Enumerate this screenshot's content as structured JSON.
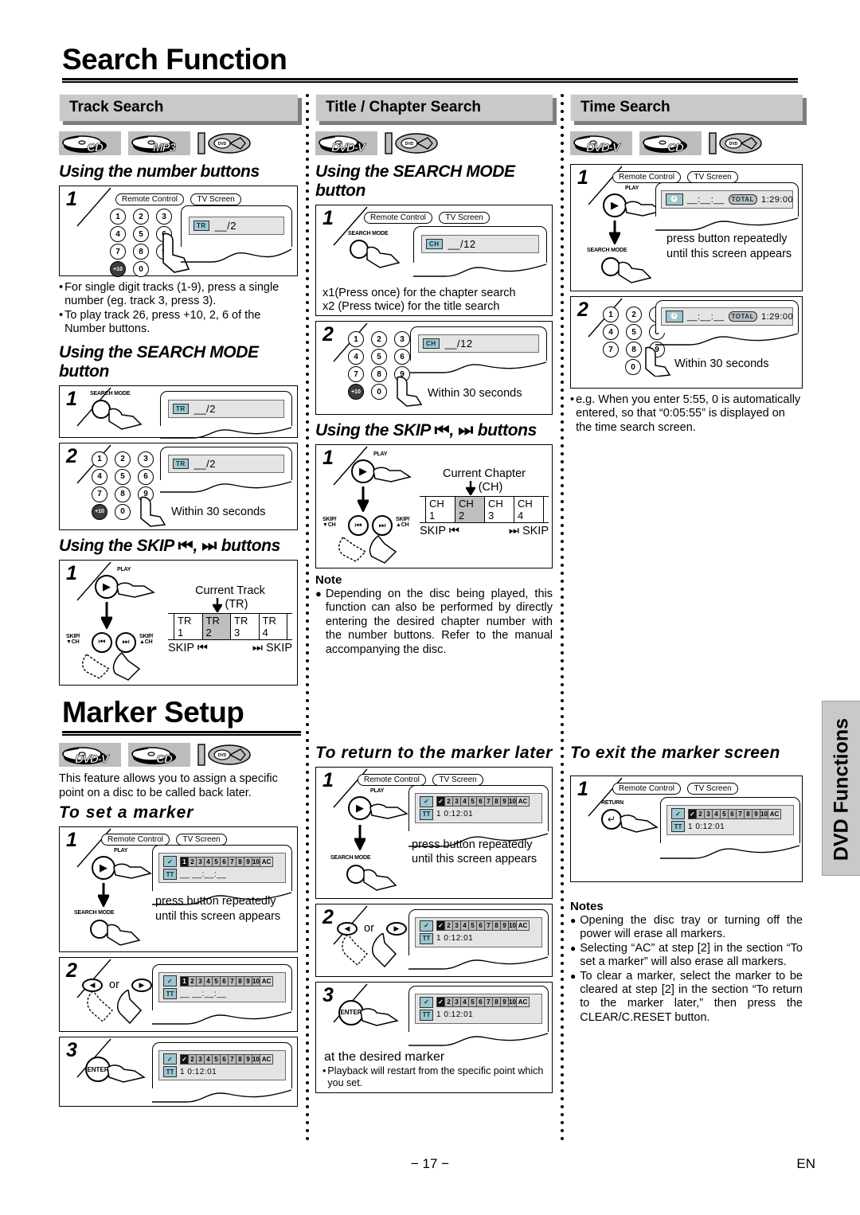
{
  "page": {
    "number": "− 17 −",
    "lang": "EN",
    "side_tab": "DVD Functions"
  },
  "sections": [
    {
      "id": "search_function",
      "title": "Search Function"
    },
    {
      "id": "marker_setup",
      "title": "Marker Setup"
    }
  ],
  "track_search": {
    "bar": "Track Search",
    "badges": [
      "CD",
      "MP3"
    ],
    "h_number": "Using the number buttons",
    "h_searchmode": "Using the SEARCH MODE button",
    "h_skip": "Using the SKIP",
    "h_skip_tail": "buttons",
    "callout_remote": "Remote Control",
    "callout_tv": "TV Screen",
    "osd_tag": "TR",
    "osd_value": "__/2",
    "searchmode_label": "SEARCH MODE",
    "within": "Within 30 seconds",
    "bullets": [
      "For single digit tracks (1-9), press a single number (eg. track 3, press 3).",
      "To play track 26, press +10, 2, 6 of the Number buttons."
    ],
    "play_label": "PLAY",
    "skip_down_label": "SKIP/▼CH",
    "skip_up_label": "SKIP/▲CH",
    "current_label": "Current Track",
    "current_unit": "(TR)",
    "cells": [
      "TR 1",
      "TR 2",
      "TR 3",
      "TR 4"
    ],
    "current_index": 1,
    "skip_left": "SKIP",
    "skip_right": "SKIP"
  },
  "title_chapter_search": {
    "bar": "Title / Chapter Search",
    "badges": [
      "DVD-V"
    ],
    "h_searchmode": "Using the SEARCH MODE button",
    "h_skip": "Using the SKIP",
    "h_skip_tail": "buttons",
    "callout_remote": "Remote Control",
    "callout_tv": "TV Screen",
    "osd_tag": "CH",
    "osd_value": "__/12",
    "searchmode_label": "SEARCH MODE",
    "press_lines": [
      "x1(Press once) for the chapter search",
      "x2 (Press twice) for the title search"
    ],
    "within": "Within 30 seconds",
    "play_label": "PLAY",
    "skip_down_label": "SKIP/▼CH",
    "skip_up_label": "SKIP/▲CH",
    "current_label": "Current Chapter",
    "current_unit": "(CH)",
    "cells": [
      "CH 1",
      "CH 2",
      "CH 3",
      "CH 4"
    ],
    "current_index": 1,
    "skip_left": "SKIP",
    "skip_right": "SKIP",
    "note_head": "Note",
    "note_body": "Depending on the disc being played, this function can also be performed by directly entering the desired chapter number with the number buttons. Refer to the manual accompanying the disc."
  },
  "time_search": {
    "bar": "Time Search",
    "badges": [
      "DVD-V",
      "CD"
    ],
    "callout_remote": "Remote Control",
    "callout_tv": "TV Screen",
    "play_label": "PLAY",
    "searchmode_label": "SEARCH MODE",
    "osd_clock_icon": "clock-icon",
    "osd_time_blank": "__:__:__",
    "osd_total_tag": "TOTAL",
    "osd_total_value": "1:29:00",
    "step1_text": "press button repeatedly until this screen appears",
    "within": "Within 30 seconds",
    "bullet": "e.g. When you enter 5:55, 0 is automatically entered, so that “0:05:55” is displayed on the time search screen."
  },
  "marker_setup": {
    "badges": [
      "DVD-V",
      "CD"
    ],
    "intro": "This feature allows you to assign a specific point on a disc to be called back later.",
    "h_set": "To set a marker",
    "h_return": "To return to the marker later",
    "h_exit": "To exit the marker screen",
    "callout_remote": "Remote Control",
    "callout_tv": "TV Screen",
    "play_label": "PLAY",
    "searchmode_label": "SEARCH MODE",
    "return_label": "RETURN",
    "enter_label": "ENTER",
    "or_label": "or",
    "check_tag": "✓",
    "tt_tag": "TT",
    "marker_cells": [
      "1",
      "2",
      "3",
      "4",
      "5",
      "6",
      "7",
      "8",
      "9",
      "10",
      "AC"
    ],
    "marker_time_blank": "__ __:__:__",
    "marker_time_set": "1  0:12:01",
    "set_step1_text": "press button repeatedly until this screen appears",
    "return_step1_text": "press button repeatedly until this screen appears",
    "return_step3_text": "at the desired marker",
    "return_step3_bullet": "Playback will restart from the specific point which you set.",
    "notes_head": "Notes",
    "notes": [
      "Opening the disc tray or turning off the power will erase all markers.",
      "Selecting “AC” at step [2] in the section “To set a marker” will also erase all markers.",
      "To clear a marker, select the marker to be cleared at step [2] in the section “To return to the marker later,” then press the CLEAR/C.RESET button."
    ]
  }
}
